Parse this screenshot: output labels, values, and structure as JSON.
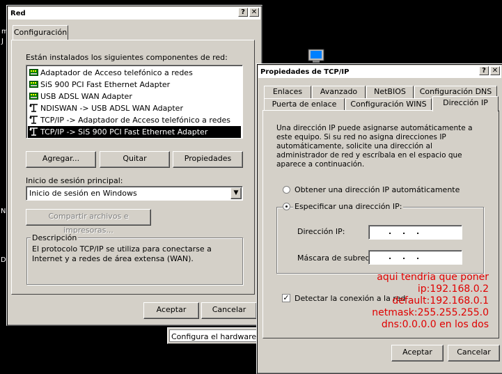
{
  "desktop": {
    "left_chars": [
      "m",
      "J",
      "N",
      "D"
    ]
  },
  "net_window": {
    "title": "Red",
    "help_btn": "?",
    "close_btn": "✕",
    "tab_label": "Configuración",
    "installed_label": "Están instalados los siguientes componentes de red:",
    "components": [
      {
        "label": "Adaptador de Acceso telefónico a redes",
        "icon": "network-adapter-icon"
      },
      {
        "label": "SiS 900 PCI Fast Ethernet Adapter",
        "icon": "network-adapter-icon"
      },
      {
        "label": "USB ADSL WAN Adapter",
        "icon": "network-adapter-icon"
      },
      {
        "label": "NDISWAN -> USB ADSL WAN Adapter",
        "icon": "protocol-icon"
      },
      {
        "label": "TCP/IP -> Adaptador de Acceso telefónico a redes",
        "icon": "protocol-icon"
      },
      {
        "label": "TCP/IP -> SiS 900 PCI Fast Ethernet Adapter",
        "icon": "protocol-icon",
        "selected": true
      }
    ],
    "add_btn": "Agregar...",
    "remove_btn": "Quitar",
    "props_btn": "Propiedades",
    "logon_label": "Inicio de sesión principal:",
    "logon_value": "Inicio de sesión en Windows",
    "share_btn": "Compartir archivos e impresoras...",
    "desc_title": "Descripción",
    "desc_text": "El protocolo TCP/IP se utiliza para conectarse a Internet y a redes de área extensa (WAN).",
    "ok_btn": "Aceptar",
    "cancel_btn": "Cancelar"
  },
  "taskbar_tooltip": "Configura el hardware y",
  "tcp_window": {
    "title": "Propiedades de TCP/IP",
    "help_btn": "?",
    "close_btn": "✕",
    "tabs_row1": [
      "Enlaces",
      "Avanzado",
      "NetBIOS",
      "Configuración DNS"
    ],
    "tabs_row2": [
      "Puerta de enlace",
      "Configuración WINS",
      "Dirección IP"
    ],
    "intro_text": "Una dirección IP puede asignarse automáticamente a este equipo. Si su red no asigna direcciones IP automáticamente, solicite una dirección al administrador de red y escríbala en el espacio que aparece a continuación.",
    "radio_auto": "Obtener una dirección IP automáticamente",
    "radio_manual": "Especificar una dirección IP:",
    "ip_label": "Dirección IP:",
    "mask_label": "Máscara de subred:",
    "ip_dots": ".   .   .",
    "detect_label": "Detectar la conexión a la red",
    "ok_btn": "Aceptar",
    "cancel_btn": "Cancelar",
    "annotation": [
      "aqui tendria que poner",
      "ip:192.168.0.2",
      "default:192.168.0.1",
      "netmask:255.255.255.0",
      "dns:0.0.0.0 en los dos"
    ],
    "annotation_color": "#e00000"
  }
}
